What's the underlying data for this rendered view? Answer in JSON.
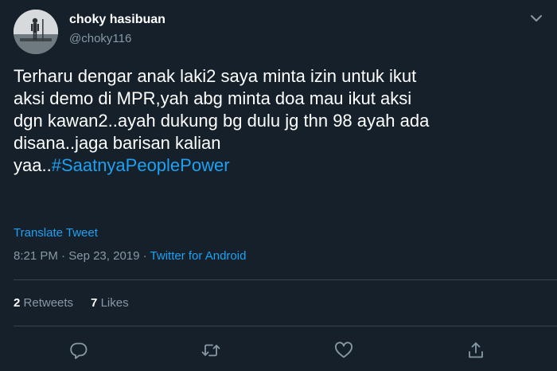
{
  "user": {
    "display_name": "choky hasibuan",
    "handle": "@choky116"
  },
  "tweet": {
    "lines": [
      "Terharu dengar anak laki2 saya minta izin untuk ikut",
      "aksi demo di MPR,yah abg minta doa mau ikut aksi",
      "dgn kawan2..ayah dukung bg dulu jg thn 98 ayah ada",
      "disana..jaga barisan kalian",
      "yaa.."
    ],
    "hashtag": "#SaatnyaPeoplePower"
  },
  "translate_label": "Translate Tweet",
  "meta": {
    "time": "8:21 PM",
    "separator": " · ",
    "date": "Sep 23, 2019",
    "separator2": " · ",
    "source": "Twitter for Android"
  },
  "stats": {
    "retweets_count": "2",
    "retweets_label": "Retweets",
    "likes_count": "7",
    "likes_label": "Likes"
  },
  "icons": {
    "more": "chevron-down-icon",
    "reply": "reply-icon",
    "retweet": "retweet-icon",
    "like": "heart-icon",
    "share": "share-icon"
  },
  "colors": {
    "background": "#15202b",
    "link": "#1da1f2",
    "secondary_text": "#8899a6",
    "divider": "#38444d"
  }
}
